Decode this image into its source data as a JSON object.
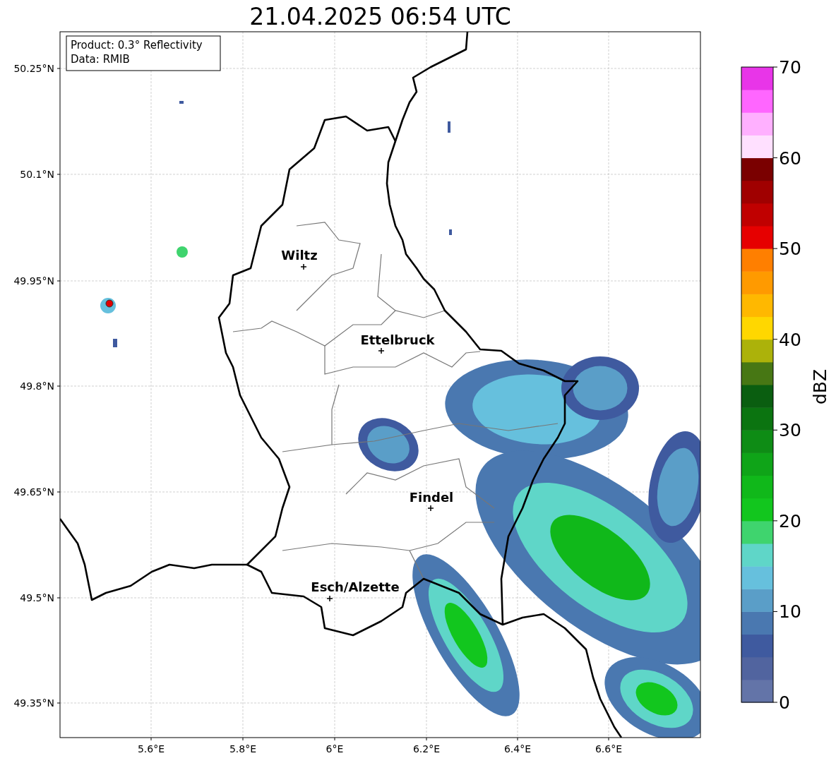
{
  "title": "21.04.2025 06:54 UTC",
  "info_box": [
    "Product: 0.3° Reflectivity",
    "Data: RMIB"
  ],
  "map": {
    "yticks": [
      "50.25°N",
      "50.1°N",
      "49.95°N",
      "49.8°N",
      "49.65°N",
      "49.5°N",
      "49.35°N"
    ],
    "xticks": [
      "5.6°E",
      "5.8°E",
      "6°E",
      "6.2°E",
      "6.4°E",
      "6.6°E"
    ],
    "places": [
      {
        "name": "Wiltz"
      },
      {
        "name": "Ettelbruck"
      },
      {
        "name": "Findel"
      },
      {
        "name": "Esch/Alzette"
      }
    ]
  },
  "colorbar": {
    "label": "dBZ",
    "ticks": [
      "70",
      "60",
      "50",
      "40",
      "30",
      "20",
      "10",
      "0"
    ],
    "bins": [
      {
        "color": "#6374a8"
      },
      {
        "color": "#51649f"
      },
      {
        "color": "#3f5a9f"
      },
      {
        "color": "#4a78b0"
      },
      {
        "color": "#5a9ec8"
      },
      {
        "color": "#66c0dd"
      },
      {
        "color": "#5fd6c8"
      },
      {
        "color": "#3fd46e"
      },
      {
        "color": "#12c61e"
      },
      {
        "color": "#10b81a"
      },
      {
        "color": "#0fa418"
      },
      {
        "color": "#0e8c15"
      },
      {
        "color": "#0b7410"
      },
      {
        "color": "#0a5e10"
      },
      {
        "color": "#477714"
      },
      {
        "color": "#acb20a"
      },
      {
        "color": "#ffd700"
      },
      {
        "color": "#ffb800"
      },
      {
        "color": "#ff9a00"
      },
      {
        "color": "#ff7f00"
      },
      {
        "color": "#e60000"
      },
      {
        "color": "#c00000"
      },
      {
        "color": "#a00000"
      },
      {
        "color": "#7a0000"
      },
      {
        "color": "#ffe0ff"
      },
      {
        "color": "#ffb0ff"
      },
      {
        "color": "#ff66ff"
      },
      {
        "color": "#e835e8"
      }
    ]
  }
}
